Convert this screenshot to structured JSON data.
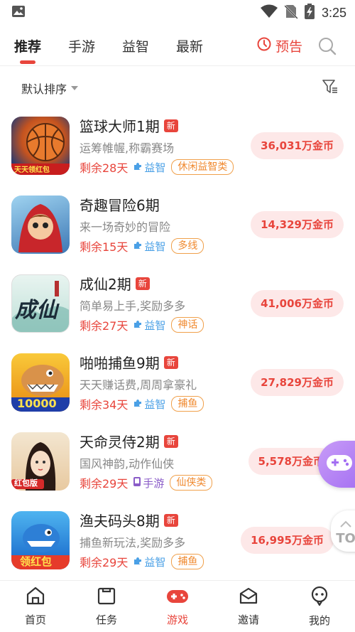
{
  "status_bar": {
    "time": "3:25"
  },
  "tabs": [
    {
      "label": "推荐",
      "active": true
    },
    {
      "label": "手游"
    },
    {
      "label": "益智"
    },
    {
      "label": "最新"
    }
  ],
  "notice": {
    "label": "预告"
  },
  "sort": {
    "label": "默认排序"
  },
  "games": [
    {
      "title": "篮球大师1期",
      "badge": "新",
      "desc": "运筹帷幄,称霸赛场",
      "remain": "剩余28天",
      "category": "益智",
      "tag": "休闲益智类",
      "reward": "36,031万金币",
      "icon_text": "天天领红包"
    },
    {
      "title": "奇趣冒险6期",
      "badge": "",
      "desc": "来一场奇妙的冒险",
      "remain": "剩余15天",
      "category": "益智",
      "tag": "多线",
      "reward": "14,329万金币",
      "icon_text": ""
    },
    {
      "title": "成仙2期",
      "badge": "新",
      "desc": "简单易上手,奖励多多",
      "remain": "剩余27天",
      "category": "益智",
      "tag": "神话",
      "reward": "41,006万金币",
      "icon_text": "成仙"
    },
    {
      "title": "啪啪捕鱼9期",
      "badge": "新",
      "desc": "天天赚话费,周周拿豪礼",
      "remain": "剩余34天",
      "category": "益智",
      "tag": "捕鱼",
      "reward": "27,829万金币",
      "icon_text": "10000"
    },
    {
      "title": "天命灵侍2期",
      "badge": "新",
      "desc": "国风神韵,动作仙侠",
      "remain": "剩余29天",
      "category": "手游",
      "tag": "仙侠类",
      "reward": "5,578万金币",
      "icon_text": "红包版"
    },
    {
      "title": "渔夫码头8期",
      "badge": "新",
      "desc": "捕鱼新玩法,奖励多多",
      "remain": "剩余29天",
      "category": "益智",
      "tag": "捕鱼",
      "reward": "16,995万金币",
      "icon_text": "领红包"
    }
  ],
  "top_button": {
    "label": "TO"
  },
  "bottom_nav": [
    {
      "label": "首页"
    },
    {
      "label": "任务"
    },
    {
      "label": "游戏",
      "active": true
    },
    {
      "label": "邀请"
    },
    {
      "label": "我的"
    }
  ],
  "colors": {
    "accent": "#e8453c",
    "tag": "#f08a30",
    "category": "#4aa0e6"
  }
}
